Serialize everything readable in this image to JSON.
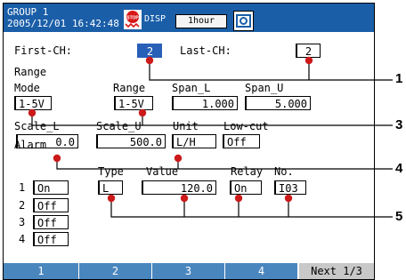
{
  "header": {
    "group": "GROUP 1",
    "datetime": "2005/12/01 16:42:48",
    "stop_icon": "stop-icon",
    "disp": "DISP",
    "time_btn": "1hour",
    "menu_icon": "display-mode-icon"
  },
  "channels": {
    "first_label": "First-CH:",
    "first_value": "2",
    "last_label": "Last-CH:",
    "last_value": "2"
  },
  "range": {
    "section": "Range",
    "mode_label": "Mode",
    "mode_value": "1-5V",
    "range_label": "Range",
    "range_value": "1-5V",
    "span_l_label": "Span_L",
    "span_l_value": "1.000",
    "span_u_label": "Span_U",
    "span_u_value": "5.000"
  },
  "scale": {
    "scale_l_label": "Scale_L",
    "scale_l_value": "0.0",
    "scale_u_label": "Scale_U",
    "scale_u_value": "500.0",
    "unit_label": "Unit",
    "unit_value": "L/H",
    "lowcut_label": "Low-cut",
    "lowcut_value": "Off"
  },
  "alarm": {
    "section": "Alarm",
    "type_label": "Type",
    "value_label": "Value",
    "relay_label": "Relay",
    "no_label": "No.",
    "rows": [
      {
        "num": "1",
        "state": "On",
        "type": "L",
        "value": "120.0",
        "relay": "On",
        "no": "I03"
      },
      {
        "num": "2",
        "state": "Off"
      },
      {
        "num": "3",
        "state": "Off"
      },
      {
        "num": "4",
        "state": "Off"
      }
    ]
  },
  "softkeys": [
    "1",
    "2",
    "3",
    "4",
    "Next 1/3"
  ],
  "callouts": [
    "1",
    "3",
    "4",
    "5"
  ],
  "colors": {
    "header": "#1a5ea8",
    "selected": "#2860b8",
    "softkey": "#4a86be",
    "callout": "#cc1a1a"
  }
}
